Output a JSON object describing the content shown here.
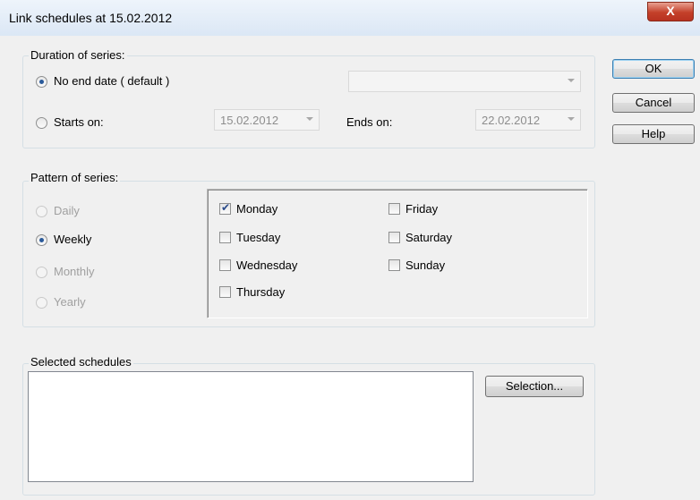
{
  "window": {
    "title": "Link schedules at 15.02.2012",
    "close_glyph": "X"
  },
  "duration": {
    "legend": "Duration of series:",
    "no_end_label": "No end date ( default )",
    "no_end_combo_value": "",
    "starts_on_label": "Starts on:",
    "starts_on_value": "15.02.2012",
    "ends_on_label": "Ends on:",
    "ends_on_value": "22.02.2012",
    "selected": "no_end"
  },
  "pattern": {
    "legend": "Pattern of series:",
    "options": [
      {
        "label": "Daily",
        "checked": false,
        "enabled": false
      },
      {
        "label": "Weekly",
        "checked": true,
        "enabled": true
      },
      {
        "label": "Monthly",
        "checked": false,
        "enabled": false
      },
      {
        "label": "Yearly",
        "checked": false,
        "enabled": false
      }
    ],
    "days": [
      {
        "label": "Monday",
        "checked": true
      },
      {
        "label": "Tuesday",
        "checked": false
      },
      {
        "label": "Wednesday",
        "checked": false
      },
      {
        "label": "Thursday",
        "checked": false
      },
      {
        "label": "Friday",
        "checked": false
      },
      {
        "label": "Saturday",
        "checked": false
      },
      {
        "label": "Sunday",
        "checked": false
      }
    ]
  },
  "selected_schedules": {
    "legend": "Selected schedules",
    "selection_button": "Selection..."
  },
  "buttons": {
    "ok": "OK",
    "cancel": "Cancel",
    "help": "Help"
  }
}
